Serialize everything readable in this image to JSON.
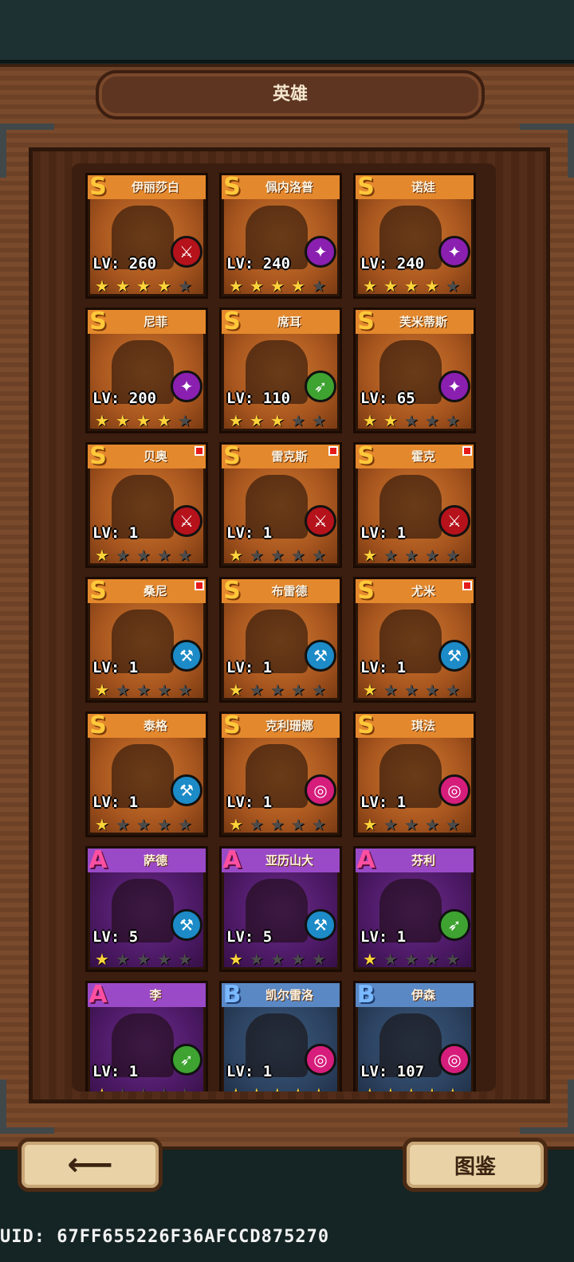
{
  "header": {
    "title": "英雄"
  },
  "heroes": [
    {
      "name": "伊丽莎白",
      "rarity": "S",
      "level": "LV: 260",
      "stars": 4,
      "class_icon": "sword-class-icon",
      "class_color": "red",
      "new": false
    },
    {
      "name": "佩内洛普",
      "rarity": "S",
      "level": "LV: 240",
      "stars": 4,
      "class_icon": "staff-class-icon",
      "class_color": "purple",
      "new": false
    },
    {
      "name": "诺娃",
      "rarity": "S",
      "level": "LV: 240",
      "stars": 4,
      "class_icon": "staff-class-icon",
      "class_color": "purple",
      "new": false
    },
    {
      "name": "尼菲",
      "rarity": "S",
      "level": "LV: 200",
      "stars": 4,
      "class_icon": "staff-class-icon",
      "class_color": "purple",
      "new": false
    },
    {
      "name": "席耳",
      "rarity": "S",
      "level": "LV: 110",
      "stars": 3,
      "class_icon": "bow-class-icon",
      "class_color": "green",
      "new": false
    },
    {
      "name": "芙米蒂斯",
      "rarity": "S",
      "level": "LV: 65",
      "stars": 2,
      "class_icon": "staff-class-icon",
      "class_color": "purple",
      "new": false
    },
    {
      "name": "贝奥",
      "rarity": "S",
      "level": "LV: 1",
      "stars": 1,
      "class_icon": "sword-class-icon",
      "class_color": "red",
      "new": true
    },
    {
      "name": "雷克斯",
      "rarity": "S",
      "level": "LV: 1",
      "stars": 1,
      "class_icon": "sword-class-icon",
      "class_color": "red",
      "new": true
    },
    {
      "name": "霍克",
      "rarity": "S",
      "level": "LV: 1",
      "stars": 1,
      "class_icon": "sword-class-icon",
      "class_color": "red",
      "new": true
    },
    {
      "name": "桑尼",
      "rarity": "S",
      "level": "LV: 1",
      "stars": 1,
      "class_icon": "hammer-class-icon",
      "class_color": "blue",
      "new": true
    },
    {
      "name": "布雷德",
      "rarity": "S",
      "level": "LV: 1",
      "stars": 1,
      "class_icon": "hammer-class-icon",
      "class_color": "blue",
      "new": false
    },
    {
      "name": "尤米",
      "rarity": "S",
      "level": "LV: 1",
      "stars": 1,
      "class_icon": "hammer-class-icon",
      "class_color": "blue",
      "new": true
    },
    {
      "name": "泰格",
      "rarity": "S",
      "level": "LV: 1",
      "stars": 1,
      "class_icon": "hammer-class-icon",
      "class_color": "blue",
      "new": false
    },
    {
      "name": "克利珊娜",
      "rarity": "S",
      "level": "LV: 1",
      "stars": 1,
      "class_icon": "orb-class-icon",
      "class_color": "pink",
      "new": false
    },
    {
      "name": "琪法",
      "rarity": "S",
      "level": "LV: 1",
      "stars": 1,
      "class_icon": "orb-class-icon",
      "class_color": "pink",
      "new": false
    },
    {
      "name": "萨德",
      "rarity": "A",
      "level": "LV: 5",
      "stars": 1,
      "class_icon": "hammer-class-icon",
      "class_color": "blue",
      "new": false
    },
    {
      "name": "亚历山大",
      "rarity": "A",
      "level": "LV: 5",
      "stars": 1,
      "class_icon": "hammer-class-icon",
      "class_color": "blue",
      "new": false
    },
    {
      "name": "芬利",
      "rarity": "A",
      "level": "LV: 1",
      "stars": 1,
      "class_icon": "bow-class-icon",
      "class_color": "green",
      "new": false
    },
    {
      "name": "李",
      "rarity": "A",
      "level": "LV: 1",
      "stars": 1,
      "class_icon": "bow-class-icon",
      "class_color": "green",
      "new": false
    },
    {
      "name": "凯尔雷洛",
      "rarity": "B",
      "level": "LV: 1",
      "stars": 5,
      "class_icon": "orb-class-icon",
      "class_color": "pink",
      "new": false
    },
    {
      "name": "伊森",
      "rarity": "B",
      "level": "LV: 107",
      "stars": 5,
      "class_icon": "orb-class-icon",
      "class_color": "pink",
      "new": false
    }
  ],
  "footer": {
    "back_icon": "back-arrow-icon",
    "back_glyph": "⟵",
    "atlas_label": "图鉴",
    "uid": "UID: 67FF655226F36AFCCD875270"
  }
}
